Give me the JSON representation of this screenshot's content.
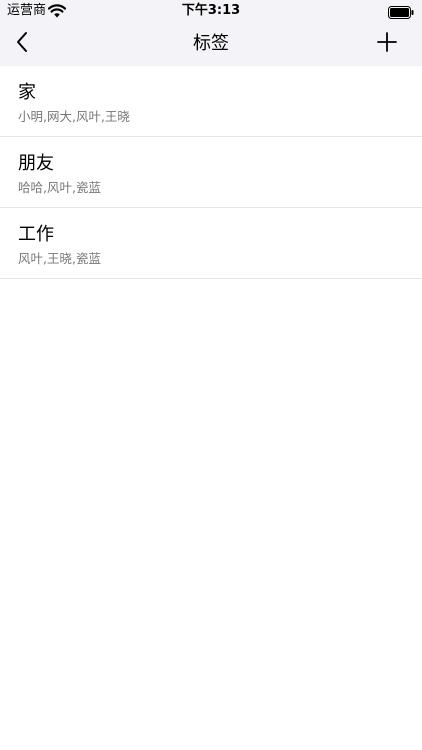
{
  "status_bar": {
    "carrier": "运营商",
    "time": "下午3:13",
    "wifi_icon": "wifi-icon",
    "battery_icon": "battery-icon"
  },
  "nav": {
    "title": "标签",
    "back_icon": "chevron-left-icon",
    "add_icon": "plus-icon"
  },
  "tags": [
    {
      "name": "家",
      "members": "小明,网大,风叶,王晓"
    },
    {
      "name": "朋友",
      "members": "哈哈,风叶,瓷蓝"
    },
    {
      "name": "工作",
      "members": "风叶,王晓,瓷蓝"
    }
  ],
  "colors": {
    "bar_background": "#f4f4f8",
    "separator": "#e6e6e9",
    "subtitle_text": "#777777"
  }
}
